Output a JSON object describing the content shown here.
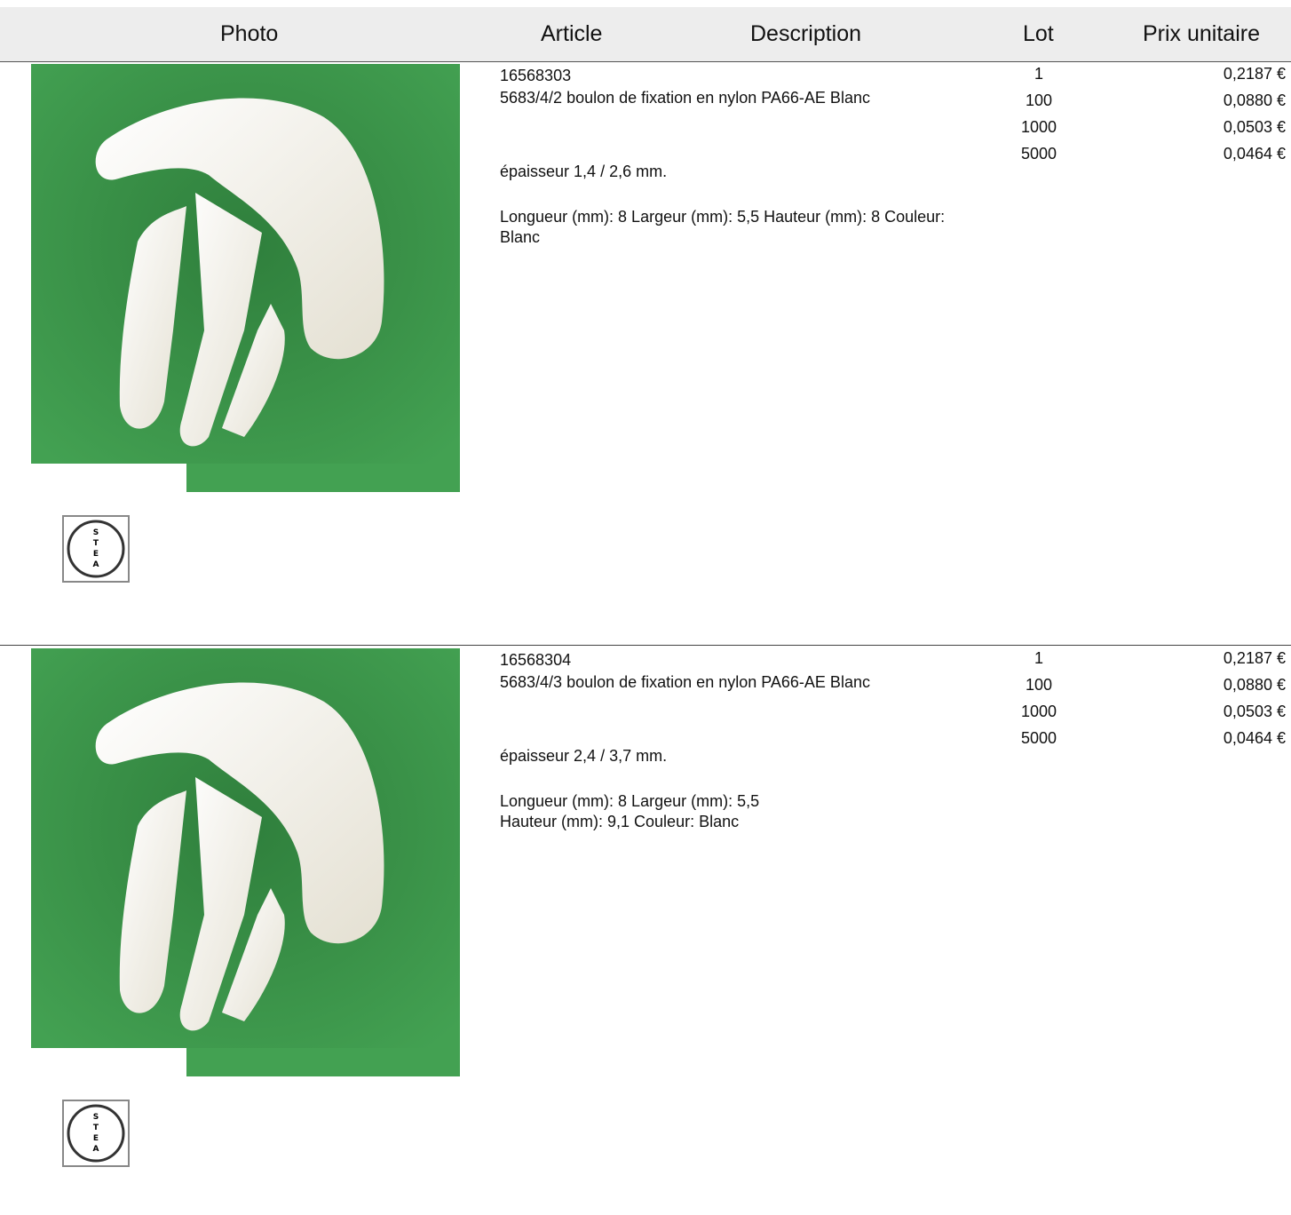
{
  "header": {
    "photo": "Photo",
    "article": "Article",
    "description": "Description",
    "lot": "Lot",
    "prix_unitaire": "Prix unitaire"
  },
  "colors": {
    "photo_background": "#3f9a50",
    "part_color": "#f3f0e6"
  },
  "products": [
    {
      "article": "16568303",
      "name": "5683/4/2 boulon de fixation en nylon PA66-AE Blanc",
      "thickness": "épaisseur 1,4 / 2,6 mm.",
      "dimensions": "Longueur (mm): 8 Largeur (mm): 5,5 Hauteur (mm): 8 Couleur: Blanc",
      "brand_icon": "stead-logo-icon",
      "tiers": [
        {
          "lot": "1",
          "price": "0,2187 €"
        },
        {
          "lot": "100",
          "price": "0,0880 €"
        },
        {
          "lot": "1000",
          "price": "0,0503 €"
        },
        {
          "lot": "5000",
          "price": "0,0464 €"
        }
      ]
    },
    {
      "article": "16568304",
      "name": "5683/4/3 boulon de fixation en nylon PA66-AE Blanc",
      "thickness": "épaisseur 2,4 / 3,7 mm.",
      "dimensions": "Longueur (mm): 8 Largeur (mm): 5,5 Hauteur (mm): 9,1 Couleur: Blanc",
      "brand_icon": "stead-logo-icon",
      "tiers": [
        {
          "lot": "1",
          "price": "0,2187 €"
        },
        {
          "lot": "100",
          "price": "0,0880 €"
        },
        {
          "lot": "1000",
          "price": "0,0503 €"
        },
        {
          "lot": "5000",
          "price": "0,0464 €"
        }
      ]
    }
  ]
}
